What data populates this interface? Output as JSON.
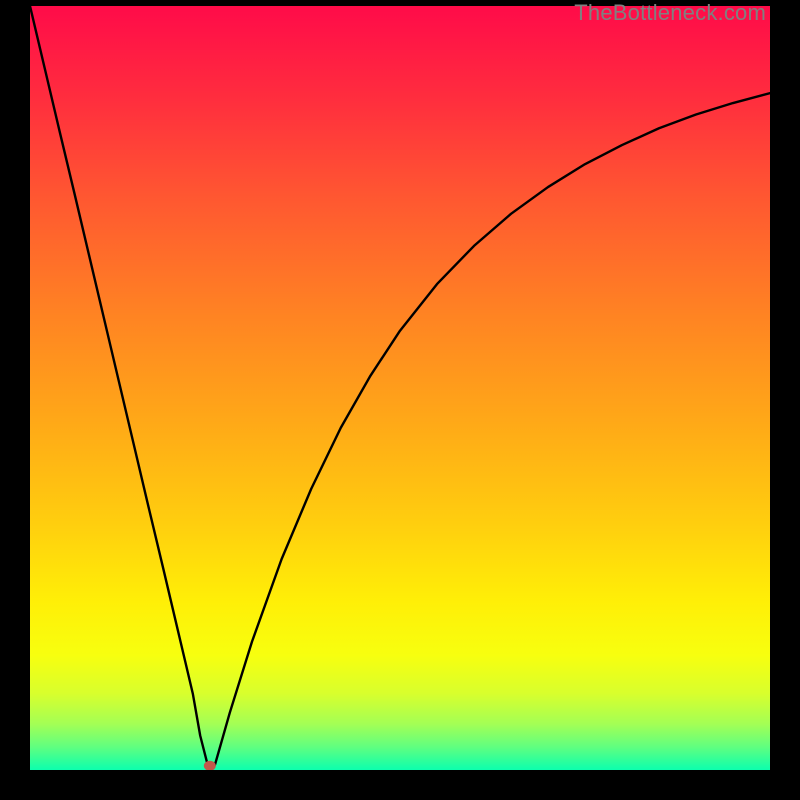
{
  "watermark": "TheBottleneck.com",
  "colors": {
    "frame_bg": "#000000",
    "curve": "#000000",
    "dot": "#c1594b",
    "gradient_stops": [
      {
        "offset": 0.0,
        "color": "#ff0b49"
      },
      {
        "offset": 0.12,
        "color": "#ff2d3e"
      },
      {
        "offset": 0.25,
        "color": "#ff5731"
      },
      {
        "offset": 0.4,
        "color": "#ff8223"
      },
      {
        "offset": 0.55,
        "color": "#ffaa17"
      },
      {
        "offset": 0.68,
        "color": "#ffcf0e"
      },
      {
        "offset": 0.78,
        "color": "#ffef07"
      },
      {
        "offset": 0.85,
        "color": "#f7ff0f"
      },
      {
        "offset": 0.9,
        "color": "#d8ff2d"
      },
      {
        "offset": 0.94,
        "color": "#a3ff55"
      },
      {
        "offset": 0.97,
        "color": "#5fff80"
      },
      {
        "offset": 1.0,
        "color": "#0cffae"
      }
    ]
  },
  "chart_data": {
    "type": "line",
    "title": "",
    "xlabel": "",
    "ylabel": "",
    "xlim": [
      0,
      100
    ],
    "ylim": [
      0,
      100
    ],
    "x": [
      0,
      2,
      4,
      6,
      8,
      10,
      12,
      14,
      16,
      18,
      20,
      21,
      22,
      23,
      24,
      25,
      27,
      30,
      34,
      38,
      42,
      46,
      50,
      55,
      60,
      65,
      70,
      75,
      80,
      85,
      90,
      95,
      100
    ],
    "values": [
      100,
      91.8,
      83.6,
      75.5,
      67.3,
      59.1,
      50.9,
      42.7,
      34.5,
      26.4,
      18.2,
      14.1,
      10.0,
      4.5,
      0.7,
      0.7,
      7.5,
      16.8,
      27.6,
      36.8,
      44.8,
      51.6,
      57.5,
      63.6,
      68.6,
      72.8,
      76.3,
      79.3,
      81.8,
      84.0,
      85.8,
      87.3,
      88.6
    ],
    "marker": {
      "x": 24.3,
      "y": 0.55
    }
  }
}
